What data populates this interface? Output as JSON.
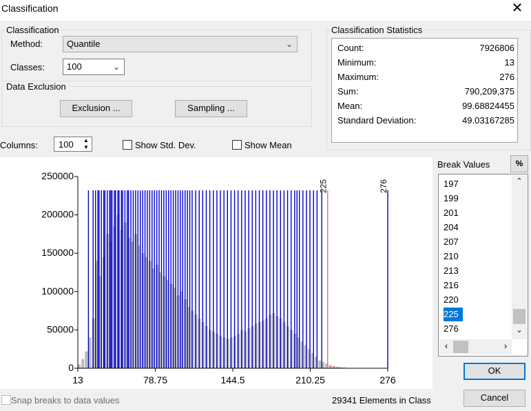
{
  "window": {
    "title": "Classification",
    "close_glyph": "✕"
  },
  "classification": {
    "legend": "Classification",
    "method_label": "Method:",
    "method_value": "Quantile",
    "classes_label": "Classes:",
    "classes_value": "100"
  },
  "exclusion": {
    "legend": "Data Exclusion",
    "exclusion_button": "Exclusion ...",
    "sampling_button": "Sampling ..."
  },
  "statistics": {
    "legend": "Classification Statistics",
    "rows": [
      {
        "label": "Count:",
        "value": "7926806"
      },
      {
        "label": "Minimum:",
        "value": "13"
      },
      {
        "label": "Maximum:",
        "value": "276"
      },
      {
        "label": "Sum:",
        "value": "790,209,375"
      },
      {
        "label": "Mean:",
        "value": "99.68824455"
      },
      {
        "label": "Standard Deviation:",
        "value": "49.03167285"
      }
    ]
  },
  "options": {
    "columns_label": "Columns:",
    "columns_value": "100",
    "show_std_dev": "Show Std. Dev.",
    "show_mean": "Show Mean"
  },
  "break_values": {
    "label": "Break Values",
    "percent_button": "%",
    "items": [
      "197",
      "199",
      "201",
      "204",
      "207",
      "210",
      "213",
      "216",
      "220",
      "225",
      "276"
    ],
    "selected": "225"
  },
  "footer": {
    "snap_label": "Snap breaks to data values",
    "elements_text": "29341 Elements in Class",
    "ok": "OK",
    "cancel": "Cancel"
  },
  "chart_data": {
    "type": "bar",
    "xlim": [
      13,
      276
    ],
    "ylim": [
      0,
      250000
    ],
    "xticks": [
      "13",
      "78.75",
      "144.5",
      "210.25",
      "276"
    ],
    "yticks": [
      "0",
      "50000",
      "100000",
      "150000",
      "200000",
      "250000"
    ],
    "histogram_x": [
      13,
      16,
      19,
      22,
      25,
      28,
      31,
      34,
      37,
      40,
      43,
      46,
      49,
      52,
      55,
      58,
      61,
      64,
      67,
      70,
      73,
      76,
      79,
      82,
      85,
      88,
      91,
      94,
      97,
      100,
      103,
      106,
      109,
      112,
      115,
      118,
      121,
      124,
      127,
      130,
      133,
      136,
      139,
      142,
      145,
      148,
      151,
      154,
      157,
      160,
      163,
      166,
      169,
      172,
      175,
      178,
      181,
      184,
      187,
      190,
      193,
      196,
      199,
      202,
      205,
      208,
      211,
      214,
      217,
      220,
      223,
      226,
      229,
      232,
      235,
      238
    ],
    "histogram_values": [
      5000,
      12000,
      22000,
      40000,
      65000,
      140000,
      120000,
      145000,
      175000,
      165000,
      185000,
      200000,
      180000,
      190000,
      170000,
      165000,
      175000,
      160000,
      150000,
      145000,
      140000,
      130000,
      135000,
      125000,
      120000,
      115000,
      110000,
      105000,
      95000,
      100000,
      90000,
      80000,
      75000,
      70000,
      65000,
      60000,
      55000,
      50000,
      48000,
      45000,
      42000,
      40000,
      38000,
      40000,
      42000,
      45000,
      50000,
      48000,
      52000,
      55000,
      58000,
      60000,
      62000,
      65000,
      70000,
      72000,
      68000,
      65000,
      60000,
      55000,
      50000,
      45000,
      40000,
      35000,
      30000,
      25000,
      20000,
      15000,
      10000,
      8000,
      6000,
      4000,
      3000,
      2000,
      1500,
      1000
    ],
    "break_positions": [
      22,
      26,
      28,
      30,
      31,
      33,
      35,
      36,
      38,
      40,
      41,
      42,
      44,
      45,
      47,
      48,
      50,
      51,
      53,
      55,
      56,
      58,
      60,
      62,
      64,
      66,
      68,
      70,
      72,
      74,
      76,
      78,
      80,
      82,
      84,
      86,
      88,
      90,
      92,
      94,
      96,
      98,
      100,
      102,
      104,
      106,
      108,
      110,
      113,
      116,
      119,
      122,
      125,
      128,
      131,
      134,
      137,
      140,
      143,
      146,
      149,
      152,
      155,
      158,
      161,
      164,
      167,
      170,
      173,
      176,
      179,
      182,
      185,
      188,
      191,
      194,
      197,
      199,
      201,
      204,
      207,
      210,
      213,
      216,
      220,
      225,
      276
    ],
    "selected_break": 225,
    "last_break": 276,
    "colors": {
      "bars": "#bdbdbd",
      "breaks": "#0000c8",
      "selected_break": "#e07070",
      "overflow_bars": "#d9a0a0"
    }
  }
}
